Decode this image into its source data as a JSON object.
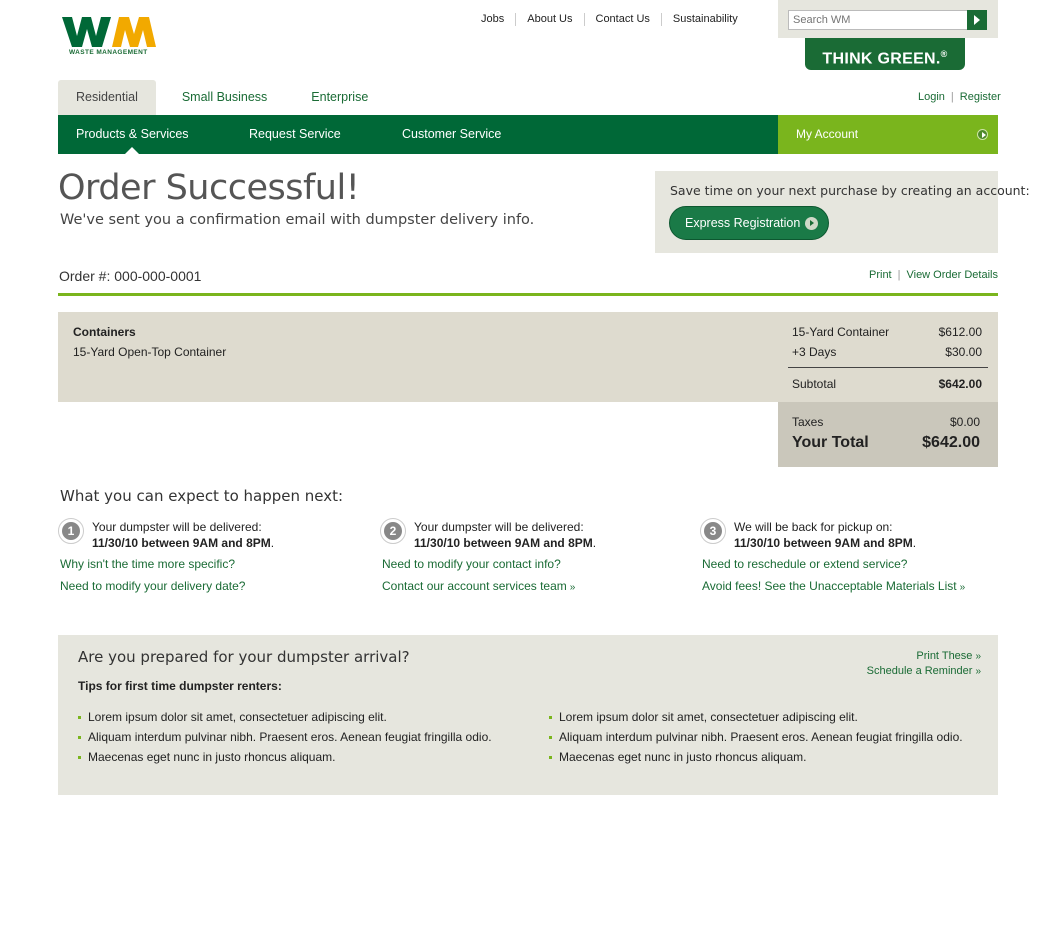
{
  "brand": {
    "logo_text": "WM",
    "logo_subtext": "WASTE MANAGEMENT",
    "tagline": "THINK GREEN.",
    "tagline_mark": "®",
    "colors": {
      "green": "#006837",
      "lime": "#7ab51d",
      "yellow": "#f2a900"
    }
  },
  "top_links": [
    "Jobs",
    "About Us",
    "Contact Us",
    "Sustainability"
  ],
  "search": {
    "placeholder": "Search WM",
    "button_icon": "arrow-right-icon"
  },
  "segments": [
    {
      "label": "Residential",
      "active": true
    },
    {
      "label": "Small Business",
      "active": false
    },
    {
      "label": "Enterprise",
      "active": false
    }
  ],
  "auth": {
    "login": "Login",
    "separator": "|",
    "register": "Register"
  },
  "nav": [
    {
      "label": "Products & Services",
      "active": true
    },
    {
      "label": "Request Service",
      "active": false
    },
    {
      "label": "Customer Service",
      "active": false
    }
  ],
  "my_account": "My Account",
  "confirmation": {
    "title": "Order Successful!",
    "subtitle": "We've sent you a confirmation email with dumpster delivery info."
  },
  "registration": {
    "prompt": "Save time on your next purchase by creating an account:",
    "button": "Express Registration"
  },
  "order": {
    "number_label": "Order #:",
    "number": "000-000-0001",
    "print": "Print",
    "separator": "|",
    "view_details": "View Order Details",
    "category": "Containers",
    "item": "15-Yard Open-Top Container",
    "lines": [
      {
        "label": "15-Yard Container",
        "amount": "$612.00"
      },
      {
        "label": "+3 Days",
        "amount": "$30.00"
      }
    ],
    "subtotal_label": "Subtotal",
    "subtotal": "$642.00",
    "taxes_label": "Taxes",
    "taxes": "$0.00",
    "total_label": "Your Total",
    "total": "$642.00"
  },
  "next_steps": {
    "title": "What you can expect to happen next:",
    "steps": [
      {
        "number": "1",
        "text": "Your dumpster will be delivered:",
        "date": "11/30/10 between 9AM and 8PM",
        "link1": "Why isn't the time more specific?",
        "link2": "Need to modify your delivery date?"
      },
      {
        "number": "2",
        "text": "Your dumpster will be delivered:",
        "date": "11/30/10 between 9AM and 8PM",
        "link1": "Need to modify your contact info?",
        "link2": "Contact our account services team"
      },
      {
        "number": "3",
        "text": "We will be back for pickup on:",
        "date": "11/30/10 between 9AM and 8PM",
        "link1": "Need to reschedule or extend service?",
        "link2": "Avoid fees! See the Unacceptable Materials List"
      }
    ]
  },
  "tips": {
    "title": "Are you prepared for your dumpster arrival?",
    "subtitle": "Tips for first time dumpster renters:",
    "print": "Print These",
    "reminder": "Schedule a Reminder",
    "left": [
      "Lorem ipsum dolor sit amet, consectetuer adipiscing elit.",
      "Aliquam interdum pulvinar nibh. Praesent eros. Aenean feugiat fringilla odio.",
      "Maecenas eget nunc in justo rhoncus aliquam."
    ],
    "right": [
      "Lorem ipsum dolor sit amet, consectetuer adipiscing elit.",
      "Aliquam interdum pulvinar nibh. Praesent eros. Aenean feugiat fringilla odio.",
      "Maecenas eget nunc in justo rhoncus aliquam."
    ]
  }
}
